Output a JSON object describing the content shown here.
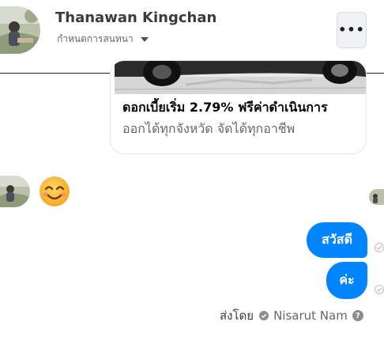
{
  "header": {
    "contact_name": "Thanawan Kingchan",
    "customize_label": "กำหนดการสนทนา",
    "more_icon": "more-horizontal-icon",
    "more_glyph": "•••"
  },
  "ad_card": {
    "title": "ดอกเบี้ยเริ่ม 2.79% ฟรีค่าดำเนินการ",
    "subtitle": "ออกได้ทุกจังหวัด จัดได้ทุกอาชีพ"
  },
  "messages": {
    "incoming_emoji": "smiling-face-with-smiling-eyes",
    "outgoing": [
      {
        "text": "สวัสดี"
      },
      {
        "text": "ค่ะ"
      }
    ]
  },
  "sent_by": {
    "label": "ส่งโดย",
    "name": "Nisarut Nam",
    "help_glyph": "?"
  },
  "colors": {
    "bubble": "#0084ff",
    "muted_text": "#65676b",
    "header_button_bg": "#f0f2f5"
  }
}
